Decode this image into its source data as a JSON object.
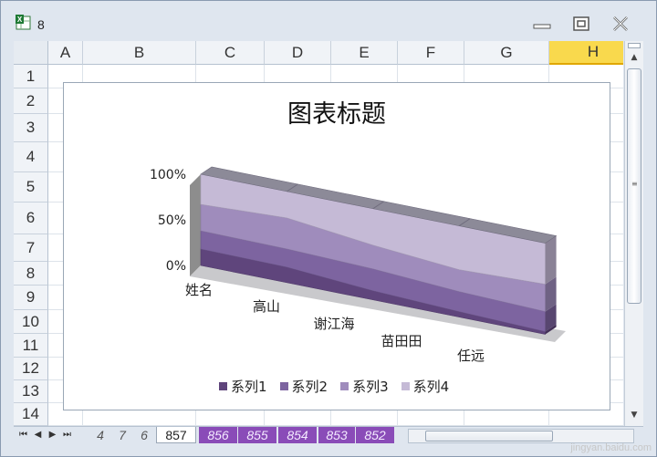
{
  "window": {
    "title": "8",
    "app_icon": "excel-icon",
    "controls": [
      "minimize-icon",
      "restore-icon",
      "close-icon"
    ]
  },
  "columns": [
    "A",
    "B",
    "C",
    "D",
    "E",
    "F",
    "G",
    "H"
  ],
  "selected_column": "H",
  "rows": [
    "1",
    "2",
    "3",
    "4",
    "5",
    "6",
    "7",
    "8",
    "9",
    "10",
    "11",
    "12",
    "13",
    "14"
  ],
  "sheet_tabs": [
    "4",
    "7",
    "6",
    "857",
    "856",
    "855",
    "854",
    "853",
    "852"
  ],
  "active_tab": "857",
  "chart_data": {
    "type": "area",
    "subtype": "3d-100%-stacked-area",
    "title": "图表标题",
    "categories": [
      "姓名",
      "高山",
      "谢江海",
      "苗田田",
      "任远"
    ],
    "y_tick_labels": [
      "0%",
      "50%",
      "100%"
    ],
    "ylim": [
      0,
      100
    ],
    "series": [
      {
        "name": "系列1",
        "values": [
          18,
          17,
          10,
          6,
          3
        ],
        "color": "#5f457c"
      },
      {
        "name": "系列2",
        "values": [
          20,
          20,
          24,
          22,
          22
        ],
        "color": "#7d64a0"
      },
      {
        "name": "系列3",
        "values": [
          29,
          34,
          26,
          24,
          30
        ],
        "color": "#9f8cbc"
      },
      {
        "name": "系列4",
        "values": [
          33,
          29,
          40,
          48,
          45
        ],
        "color": "#c5bad6"
      }
    ],
    "legend_position": "bottom"
  },
  "watermark": "jingyan.baidu.com"
}
